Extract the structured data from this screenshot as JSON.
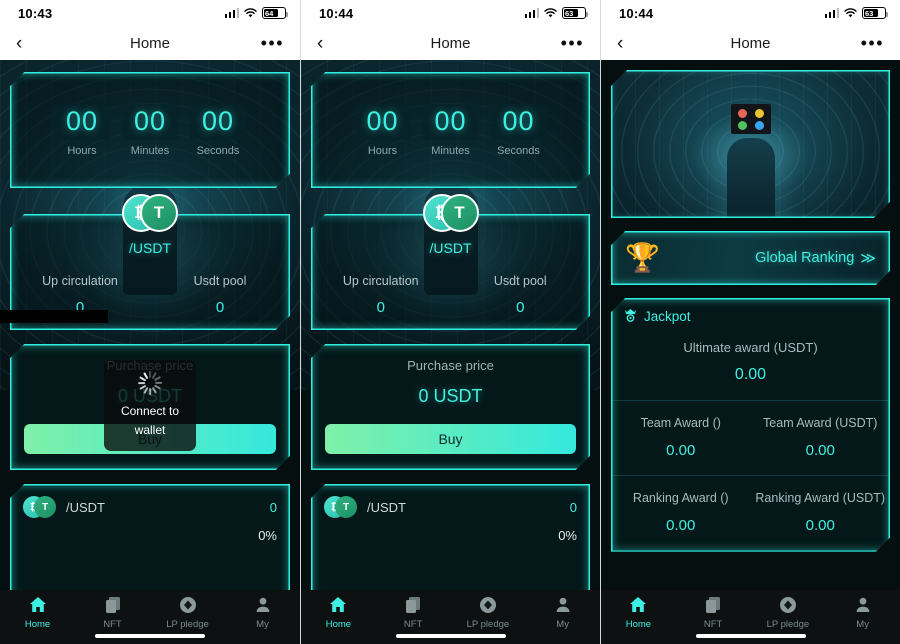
{
  "panels": [
    {
      "status": {
        "time": "10:43",
        "battery": "64"
      },
      "nav": {
        "back": "‹",
        "title": "Home",
        "more": "•••"
      },
      "countdown": {
        "units": [
          {
            "value": "00",
            "label": "Hours"
          },
          {
            "value": "00",
            "label": "Minutes"
          },
          {
            "value": "00",
            "label": "Seconds"
          }
        ]
      },
      "pair": {
        "symbol_left": "₿",
        "symbol_right": "T",
        "name": "/USDT",
        "stats": [
          {
            "key": "Up circulation",
            "value": "0"
          },
          {
            "key": "Usdt pool",
            "value": "0"
          }
        ]
      },
      "purchase": {
        "label": "Purchase price",
        "value": "0 USDT",
        "buy_label": "Buy"
      },
      "list": {
        "name": "/USDT",
        "value": "0",
        "percent": "0%"
      },
      "toast": {
        "text": "Connect to wallet",
        "visible": true
      }
    },
    {
      "status": {
        "time": "10:44",
        "battery": "63"
      },
      "nav": {
        "back": "‹",
        "title": "Home",
        "more": "•••"
      },
      "countdown": {
        "units": [
          {
            "value": "00",
            "label": "Hours"
          },
          {
            "value": "00",
            "label": "Minutes"
          },
          {
            "value": "00",
            "label": "Seconds"
          }
        ]
      },
      "pair": {
        "symbol_left": "₿",
        "symbol_right": "T",
        "name": "/USDT",
        "stats": [
          {
            "key": "Up circulation",
            "value": "0"
          },
          {
            "key": "Usdt pool",
            "value": "0"
          }
        ]
      },
      "purchase": {
        "label": "Purchase price",
        "value": "0 USDT",
        "buy_label": "Buy"
      },
      "list": {
        "name": "/USDT",
        "value": "0",
        "percent": "0%"
      },
      "toast": {
        "text": "",
        "visible": false
      }
    },
    {
      "status": {
        "time": "10:44",
        "battery": "63"
      },
      "nav": {
        "back": "‹",
        "title": "Home",
        "more": "•••"
      },
      "hero": {
        "dots": [
          "#e8655a",
          "#f0c330",
          "#4fc45c",
          "#3aa5ef"
        ]
      },
      "ranking": {
        "label": "Global Ranking",
        "chevron": "≫",
        "trophy": "🏆"
      },
      "jackpot": {
        "title": "Jackpot",
        "ultimate": {
          "key": "Ultimate award (USDT)",
          "value": "0.00"
        },
        "rows": [
          [
            {
              "key": "Team Award ()",
              "value": "0.00"
            },
            {
              "key": "Team Award (USDT)",
              "value": "0.00"
            }
          ],
          [
            {
              "key": "Ranking Award ()",
              "value": "0.00"
            },
            {
              "key": "Ranking Award (USDT)",
              "value": "0.00"
            }
          ]
        ]
      }
    }
  ],
  "tabs": [
    {
      "label": "Home",
      "icon": "home-icon",
      "active": true
    },
    {
      "label": "NFT",
      "icon": "cards-icon",
      "active": false
    },
    {
      "label": "LP pledge",
      "icon": "diamond-icon",
      "active": false
    },
    {
      "label": "My",
      "icon": "person-icon",
      "active": false
    }
  ],
  "colors": {
    "accent": "#3ef0e2",
    "buy_gradient_start": "#7ff0a8",
    "buy_gradient_end": "#35e8dd"
  }
}
